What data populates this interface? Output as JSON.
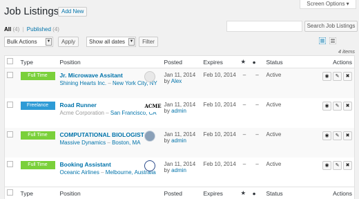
{
  "header": {
    "title": "Job Listings",
    "add_new_label": "Add New",
    "screen_options_label": "Screen Options ▾"
  },
  "filters": {
    "all_label": "All",
    "all_count": "(4)",
    "published_label": "Published",
    "published_count": "(4)",
    "separator": "|",
    "bulk_actions": "Bulk Actions",
    "apply_label": "Apply",
    "dates": "Show all dates",
    "filter_label": "Filter",
    "search_placeholder": "",
    "search_button": "Search Job Listings",
    "item_count": "4 items"
  },
  "columns": {
    "type": "Type",
    "position": "Position",
    "posted": "Posted",
    "expires": "Expires",
    "featured_icon": "star-icon",
    "filled_icon": "user-icon",
    "status": "Status",
    "actions": "Actions"
  },
  "colors": {
    "full_time": "#7ad03a",
    "freelance": "#2e9bd6",
    "link": "#0073aa"
  },
  "rows": [
    {
      "type": "Full Time",
      "type_color": "#7ad03a",
      "title": "Jr. Microwave Assitant",
      "company": "Shining Hearts Inc.",
      "loc_sep": " – ",
      "location": "New York City, NY",
      "posted": "Jan 11, 2014",
      "by_prefix": "by ",
      "author": "Alex",
      "expires": "Feb 10, 2014",
      "featured": "–",
      "filled": "–",
      "status": "Active"
    },
    {
      "type": "Freelance",
      "type_color": "#2e9bd6",
      "title": "Road Runner",
      "company": "Acme Corporation",
      "loc_sep": " – ",
      "location": "San Francisco, CA",
      "posted": "Jan 11, 2014",
      "by_prefix": "by ",
      "author": "admin",
      "expires": "Feb 10, 2014",
      "featured": "–",
      "filled": "–",
      "status": "Active",
      "logo_text": "ACME"
    },
    {
      "type": "Full Time",
      "type_color": "#7ad03a",
      "title": "COMPUTATIONAL BIOLOGIST",
      "company": "Massive Dynamics",
      "loc_sep": " – ",
      "location": "Boston, MA",
      "posted": "Jan 11, 2014",
      "by_prefix": "by ",
      "author": "admin",
      "expires": "Feb 10, 2014",
      "featured": "–",
      "filled": "–",
      "status": "Active"
    },
    {
      "type": "Full Time",
      "type_color": "#7ad03a",
      "title": "Booking Assistant",
      "company": "Oceanic Airlines",
      "loc_sep": " – ",
      "location": "Melbourne, Australia",
      "posted": "Jan 11, 2014",
      "by_prefix": "by ",
      "author": "admin",
      "expires": "Feb 10, 2014",
      "featured": "–",
      "filled": "–",
      "status": "Active"
    }
  ],
  "row_actions": {
    "view_icon": "eye-icon",
    "edit_icon": "pencil-icon",
    "delete_icon": "close-icon"
  }
}
